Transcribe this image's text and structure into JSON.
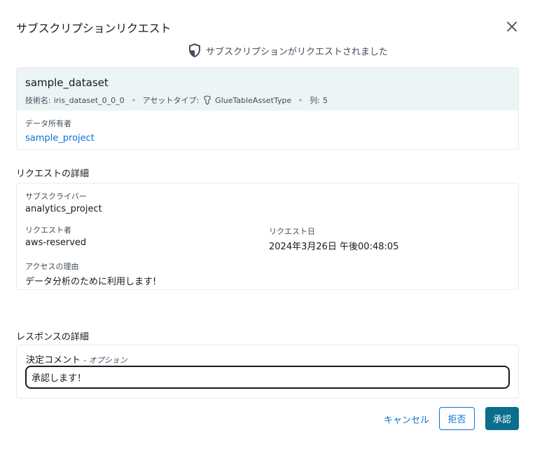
{
  "modal": {
    "title": "サブスクリプションリクエスト",
    "close_icon": "close-icon",
    "status_icon": "shield-icon",
    "status_text": "サブスクリプションがリクエストされました"
  },
  "asset": {
    "name": "sample_dataset",
    "technical_name_label": "技術名:",
    "technical_name_value": "iris_dataset_0_0_0",
    "asset_type_label": "アセットタイプ:",
    "asset_type_icon": "glue-icon",
    "asset_type_value": "GlueTableAssetType",
    "columns_label": "列:",
    "columns_value": "5",
    "owner_label": "データ所有者",
    "owner_value": "sample_project"
  },
  "request_details": {
    "title": "リクエストの詳細",
    "subscriber_label": "サブスクライバー",
    "subscriber_value": "analytics_project",
    "requester_label": "リクエスト者",
    "requester_value": "aws-reserved",
    "request_date_label": "リクエスト日",
    "request_date_value": "2024年3月26日 午後00:48:05",
    "reason_label": "アクセスの理由",
    "reason_value": "データ分析のために利用します!"
  },
  "response_details": {
    "title": "レスポンスの詳細",
    "comment_label": "決定コメント",
    "comment_optional": "- オプション",
    "comment_value": "承認します！"
  },
  "actions": {
    "cancel_label": "キャンセル",
    "reject_label": "拒否",
    "approve_label": "承認"
  },
  "colors": {
    "primary": "#0b6e8c",
    "link": "#0972d3",
    "header_bg": "#edf4f6"
  }
}
